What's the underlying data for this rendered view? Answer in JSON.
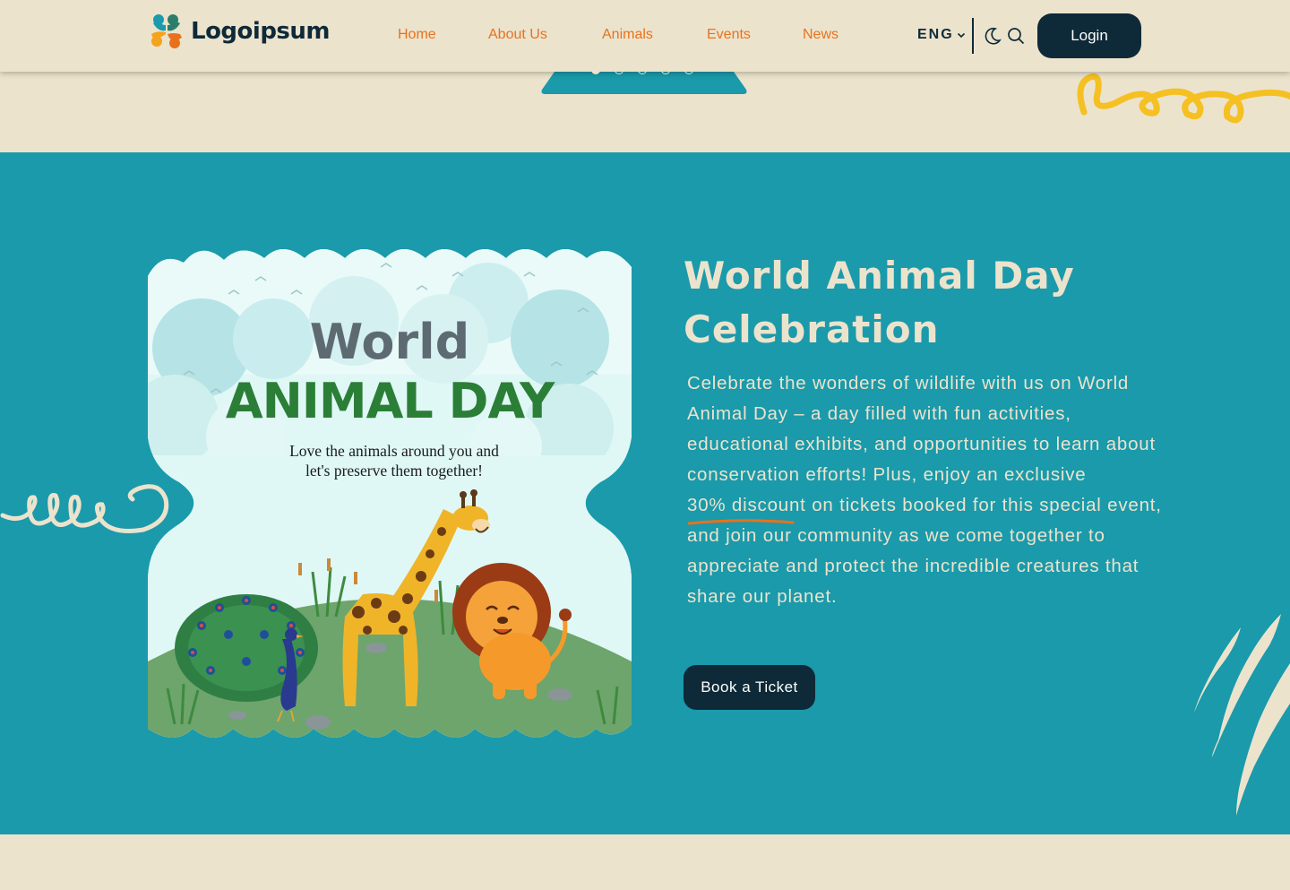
{
  "header": {
    "logo_text": "Logoipsum",
    "nav": [
      {
        "label": "Home"
      },
      {
        "label": "About Us"
      },
      {
        "label": "Animals"
      },
      {
        "label": "Events"
      },
      {
        "label": "News"
      }
    ],
    "language": "ENG",
    "login_label": "Login"
  },
  "hero": {
    "slide_count": 5,
    "active_slide": 1
  },
  "event": {
    "poster": {
      "title_line1": "World",
      "title_line2": "ANIMAL DAY",
      "subtitle_line1": "Love the animals around you and",
      "subtitle_line2": "let's preserve them together!"
    },
    "title": "World Animal Day Celebration",
    "desc_before": "Celebrate the wonders of wildlife with us on World Animal Day – a day filled with fun activities, educational exhibits, and opportunities to learn about conservation efforts! Plus, enjoy an exclusive",
    "highlight": "30% discount",
    "desc_after": "on tickets booked for this special event, and join our community as we come together to appreciate and protect the incredible creatures that share our planet.",
    "cta_label": "Book a Ticket"
  },
  "colors": {
    "background": "#ece3cd",
    "teal": "#1a9aab",
    "navy": "#0e2a38",
    "orange": "#e8721c",
    "yellow": "#f5c021"
  },
  "icons": [
    "logo-mark-icon",
    "chevron-down-icon",
    "moon-icon",
    "search-icon",
    "swirl-decoration-icon",
    "claw-marks-icon"
  ]
}
